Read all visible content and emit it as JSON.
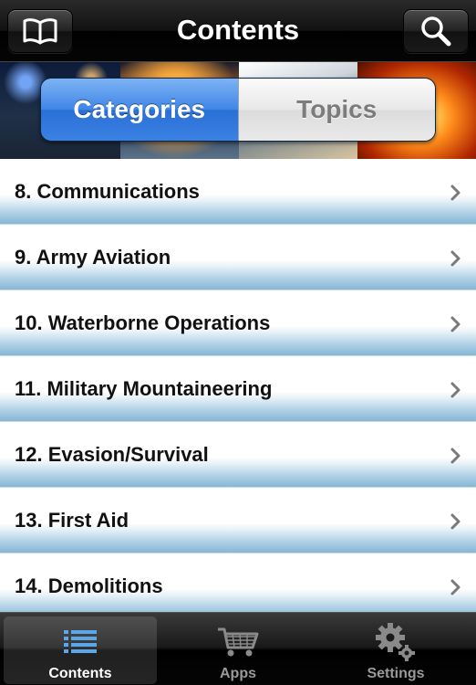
{
  "nav": {
    "title": "Contents",
    "left_icon": "book-icon",
    "right_icon": "search-icon"
  },
  "banner": {
    "segments": [
      {
        "label": "Categories",
        "selected": true
      },
      {
        "label": "Topics",
        "selected": false
      }
    ]
  },
  "list": {
    "items": [
      {
        "label": "8. Communications"
      },
      {
        "label": "9. Army Aviation"
      },
      {
        "label": "10. Waterborne Operations"
      },
      {
        "label": "11. Military Mountaineering"
      },
      {
        "label": "12. Evasion/Survival"
      },
      {
        "label": "13. First Aid"
      },
      {
        "label": "14. Demolitions"
      }
    ]
  },
  "tabbar": {
    "tabs": [
      {
        "label": "Contents",
        "icon": "list-icon",
        "selected": true
      },
      {
        "label": "Apps",
        "icon": "cart-icon",
        "selected": false
      },
      {
        "label": "Settings",
        "icon": "gears-icon",
        "selected": false
      }
    ]
  },
  "colors": {
    "accent": "#3f86e6",
    "row_gradient_bottom": "#86b6d6",
    "tab_icon_active": "#5aa8ea"
  }
}
